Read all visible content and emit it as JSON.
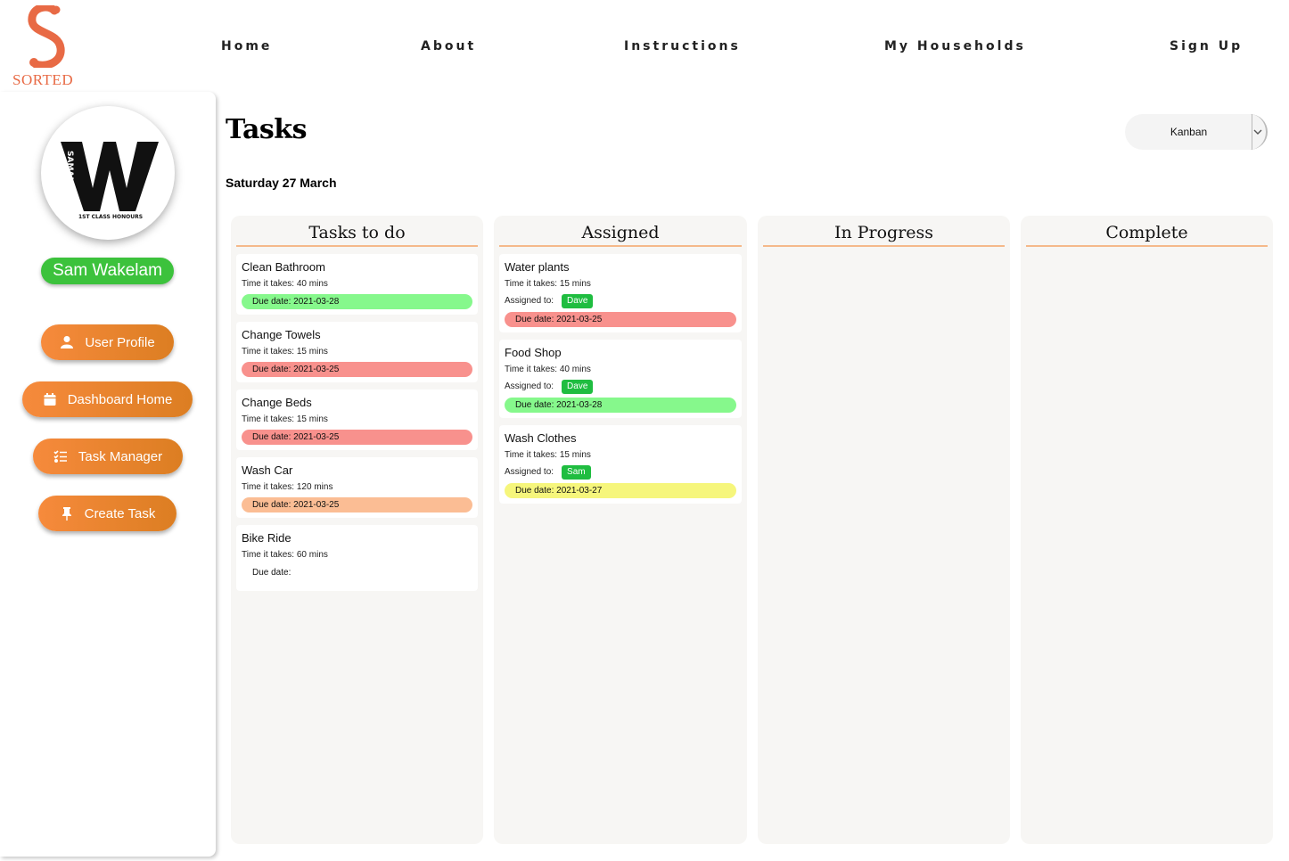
{
  "brand": {
    "name": "SORTED",
    "color": "#e86a45"
  },
  "nav": {
    "home": "Home",
    "about": "About",
    "instructions": "Instructions",
    "households": "My Households",
    "signup": "Sign Up"
  },
  "sidebar": {
    "user_name": "Sam Wakelam",
    "avatar_text": {
      "name": "SAMANTHA",
      "caption": "1ST CLASS HONOURS"
    },
    "buttons": {
      "user_profile": "User Profile",
      "dashboard_home": "Dashboard Home",
      "task_manager": "Task Manager",
      "create_task": "Create Task"
    }
  },
  "main": {
    "title": "Tasks",
    "date": "Saturday 27 March",
    "view_select": {
      "value": "Kanban"
    }
  },
  "columns": {
    "todo": {
      "title": "Tasks to do",
      "cards": [
        {
          "title": "Clean Bathroom",
          "time": "Time it takes: 40 mins",
          "due": "Due date: 2021-03-28",
          "due_status": "green"
        },
        {
          "title": "Change Towels",
          "time": "Time it takes: 15 mins",
          "due": "Due date: 2021-03-25",
          "due_status": "red"
        },
        {
          "title": "Change Beds",
          "time": "Time it takes: 15 mins",
          "due": "Due date: 2021-03-25",
          "due_status": "red"
        },
        {
          "title": "Wash Car",
          "time": "Time it takes: 120 mins",
          "due": "Due date: 2021-03-25",
          "due_status": "peach"
        },
        {
          "title": "Bike Ride",
          "time": "Time it takes: 60 mins",
          "due": "Due date:",
          "due_status": "none"
        }
      ]
    },
    "assigned": {
      "title": "Assigned",
      "assigned_label": "Assigned to:",
      "cards": [
        {
          "title": "Water plants",
          "time": "Time it takes: 15 mins",
          "assignee": "Dave",
          "due": "Due date: 2021-03-25",
          "due_status": "red"
        },
        {
          "title": "Food Shop",
          "time": "Time it takes: 40 mins",
          "assignee": "Dave",
          "due": "Due date: 2021-03-28",
          "due_status": "green"
        },
        {
          "title": "Wash Clothes",
          "time": "Time it takes: 15 mins",
          "assignee": "Sam",
          "due": "Due date: 2021-03-27",
          "due_status": "yellow"
        }
      ]
    },
    "in_progress": {
      "title": "In Progress",
      "cards": []
    },
    "complete": {
      "title": "Complete",
      "cards": []
    }
  },
  "colors": {
    "accent_orange": "#f68a3c",
    "user_green": "#3cc23c",
    "due_green": "#86f88c",
    "due_red": "#f8918d",
    "due_peach": "#fbbd94",
    "due_yellow": "#f6f67c",
    "assignee_green": "#1fbd40"
  },
  "icons": {
    "user_profile": "user-icon",
    "dashboard_home": "calendar-icon",
    "task_manager": "task-list-icon",
    "create_task": "pin-icon",
    "view_select": "chevron-down-icon"
  }
}
